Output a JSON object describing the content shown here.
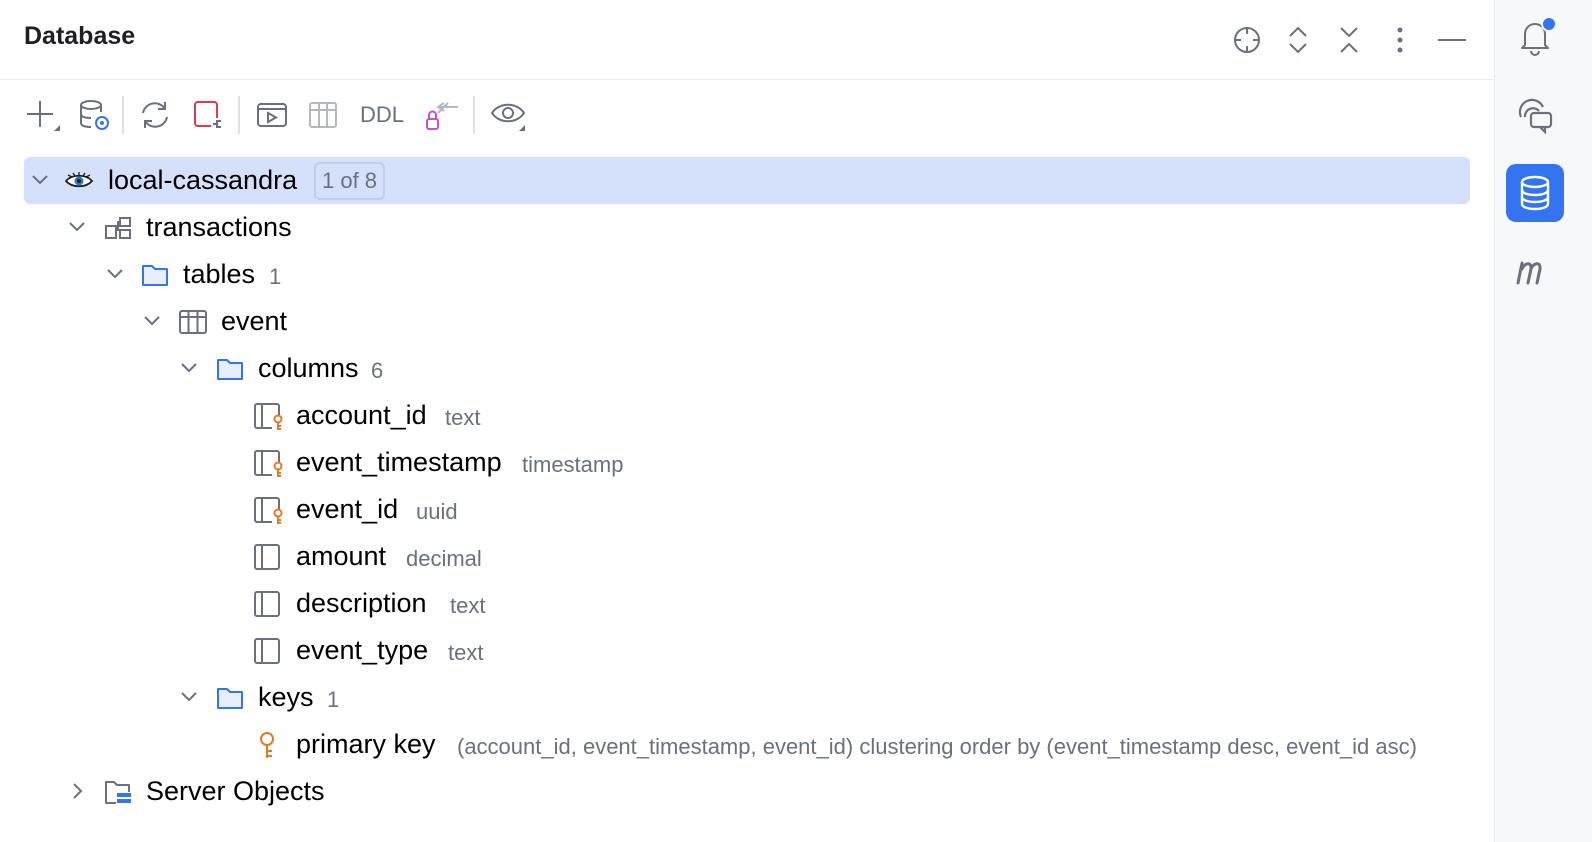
{
  "panel": {
    "title": "Database"
  },
  "header_icons": [
    "crosshair-icon",
    "expand-icon",
    "collapse-icon",
    "more-vertical-icon",
    "minimize-icon"
  ],
  "toolbar": {
    "buttons": [
      "add-icon",
      "data-source-properties-icon",
      "refresh-icon",
      "disconnect-icon",
      "open-console-icon",
      "table-view-icon",
      "ddl",
      "compare-icon",
      "view-options-icon"
    ],
    "ddl_label": "DDL"
  },
  "tree": {
    "root": {
      "label": "local-cassandra",
      "badge": "1 of 8"
    },
    "keyspace": {
      "label": "transactions"
    },
    "tables_folder": {
      "label": "tables",
      "count": "1"
    },
    "table": {
      "label": "event"
    },
    "columns_folder": {
      "label": "columns",
      "count": "6"
    },
    "columns": [
      {
        "name": "account_id",
        "type": "text",
        "key": true
      },
      {
        "name": "event_timestamp",
        "type": "timestamp",
        "key": true
      },
      {
        "name": "event_id",
        "type": "uuid",
        "key": true
      },
      {
        "name": "amount",
        "type": "decimal",
        "key": false
      },
      {
        "name": "description",
        "type": "text",
        "key": false
      },
      {
        "name": "event_type",
        "type": "text",
        "key": false
      }
    ],
    "keys_folder": {
      "label": "keys",
      "count": "1"
    },
    "primary_key": {
      "label": "primary key",
      "detail": "(account_id, event_timestamp, event_id) clustering order by (event_timestamp desc, event_id asc)"
    },
    "server_objects": {
      "label": "Server Objects"
    }
  },
  "sidebar": [
    "notifications-icon",
    "ai-chat-icon",
    "database-icon",
    "markdown-m-icon"
  ],
  "colors": {
    "selection": "#d5e0fb",
    "accent": "#3574f0",
    "key_orange": "#e07b29",
    "muted_text": "#6c707e"
  }
}
